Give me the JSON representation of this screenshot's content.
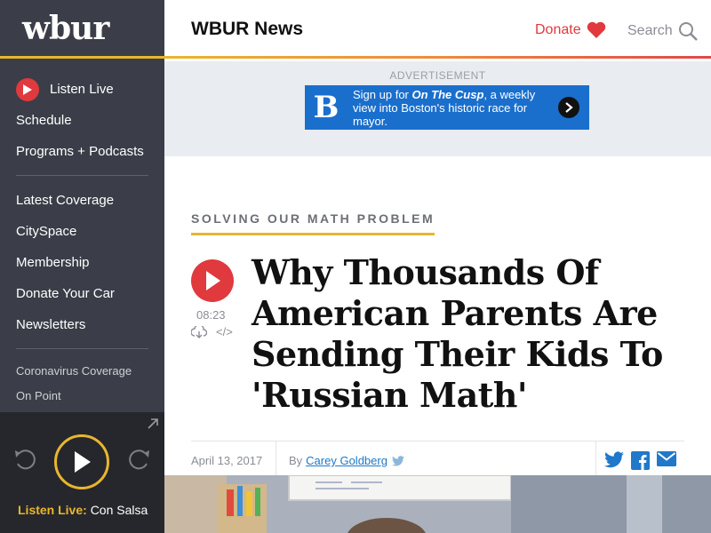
{
  "sidebar": {
    "logo": "wbur",
    "listen_live": "Listen Live",
    "items_primary": [
      "Schedule",
      "Programs + Podcasts"
    ],
    "items_secondary": [
      "Latest Coverage",
      "CitySpace",
      "Membership",
      "Donate Your Car",
      "Newsletters"
    ],
    "items_tertiary": [
      "Coronavirus Coverage",
      "On Point"
    ]
  },
  "player": {
    "label": "Listen Live:",
    "program": "Con Salsa"
  },
  "header": {
    "title": "WBUR News",
    "donate": "Donate",
    "search": "Search"
  },
  "ad": {
    "label": "ADVERTISEMENT",
    "logo": "B",
    "text_before": "Sign up for ",
    "text_bold": "On The Cusp",
    "text_after": ", a weekly view into Boston's historic race for mayor."
  },
  "article": {
    "kicker": "SOLVING OUR MATH PROBLEM",
    "duration": "08:23",
    "embed_label": "</>",
    "headline": "Why Thousands Of American Parents Are Sending Their Kids To 'Russian Math'",
    "date": "April 13, 2017",
    "by": "By",
    "author": "Carey Goldberg"
  },
  "colors": {
    "sidebar_bg": "#3b3e48",
    "accent_yellow": "#e8b62e",
    "accent_red": "#e0393e",
    "link_blue": "#1f78c9",
    "ad_blue": "#1a6fcd"
  }
}
